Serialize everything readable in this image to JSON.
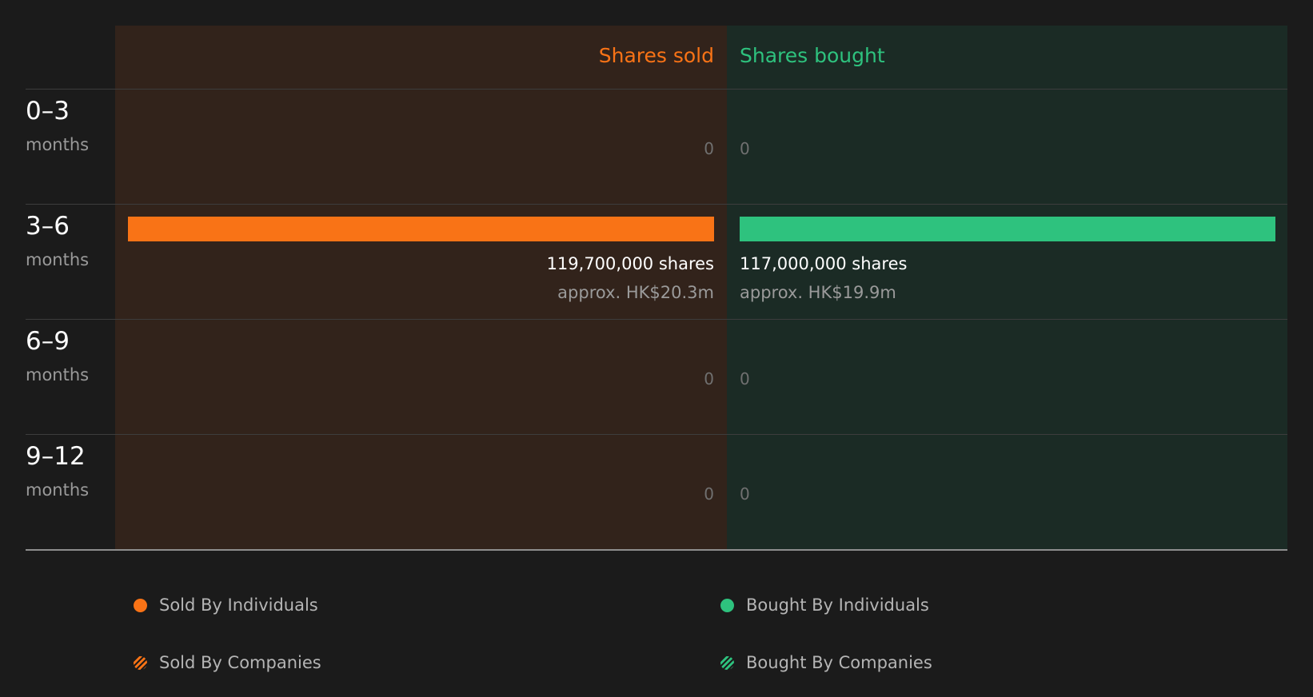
{
  "chart_data": {
    "type": "bar",
    "orientation": "horizontal",
    "headers": {
      "sold": "Shares sold",
      "bought": "Shares bought"
    },
    "rows": [
      {
        "range": "0–3",
        "unit": "months",
        "sold": 0,
        "bought": 0,
        "sold_zero_label": "0",
        "bought_zero_label": "0"
      },
      {
        "range": "3–6",
        "unit": "months",
        "sold": 119700000,
        "bought": 117000000,
        "sold_shares_label": "119,700,000 shares",
        "sold_value_label": "approx. HK$20.3m",
        "bought_shares_label": "117,000,000 shares",
        "bought_value_label": "approx. HK$19.9m"
      },
      {
        "range": "6–9",
        "unit": "months",
        "sold": 0,
        "bought": 0,
        "sold_zero_label": "0",
        "bought_zero_label": "0"
      },
      {
        "range": "9–12",
        "unit": "months",
        "sold": 0,
        "bought": 0,
        "sold_zero_label": "0",
        "bought_zero_label": "0"
      }
    ],
    "xlim": [
      0,
      119700000
    ],
    "legend": [
      {
        "label": "Sold By Individuals",
        "color": "#f97316",
        "pattern": "solid"
      },
      {
        "label": "Bought By Individuals",
        "color": "#2ec27e",
        "pattern": "solid"
      },
      {
        "label": "Sold By Companies",
        "color": "#f97316",
        "pattern": "hatched"
      },
      {
        "label": "Bought By Companies",
        "color": "#2ec27e",
        "pattern": "hatched"
      }
    ],
    "legend_placement": "bottom",
    "colors": {
      "sold": "#f97316",
      "bought": "#2ec27e",
      "background": "#1b1b1b"
    }
  }
}
